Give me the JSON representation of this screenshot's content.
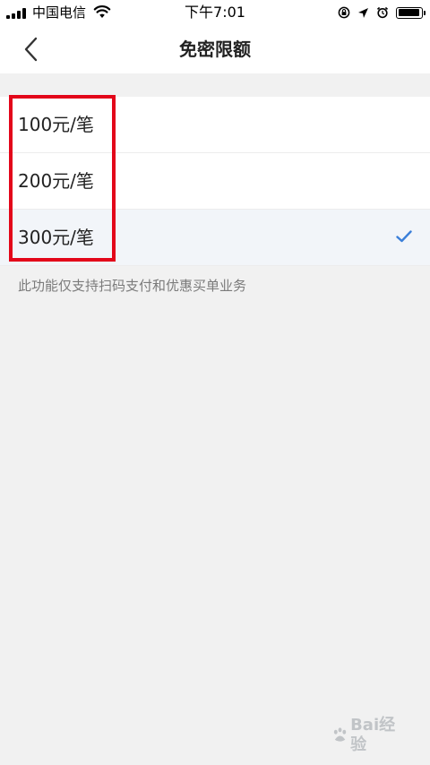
{
  "status_bar": {
    "carrier": "中国电信",
    "time": "下午7:01",
    "battery_level": 0.95,
    "icons": [
      "signal-icon",
      "wifi-icon",
      "lock-rotation-icon",
      "location-arrow-icon",
      "alarm-icon",
      "battery-icon"
    ]
  },
  "nav": {
    "title": "免密限额",
    "back_icon": "chevron-left-icon"
  },
  "options": [
    {
      "label": "100元/笔",
      "selected": false
    },
    {
      "label": "200元/笔",
      "selected": false
    },
    {
      "label": "300元/笔",
      "selected": true
    }
  ],
  "note": "此功能仅支持扫码支付和优惠买单业务",
  "colors": {
    "accent": "#3b7fd9",
    "highlight": "#e3061a",
    "background": "#f1f1f1",
    "selected_row": "#f2f5f9"
  },
  "watermark": {
    "text": "Bai经验",
    "icon": "baidu-paw-icon"
  }
}
